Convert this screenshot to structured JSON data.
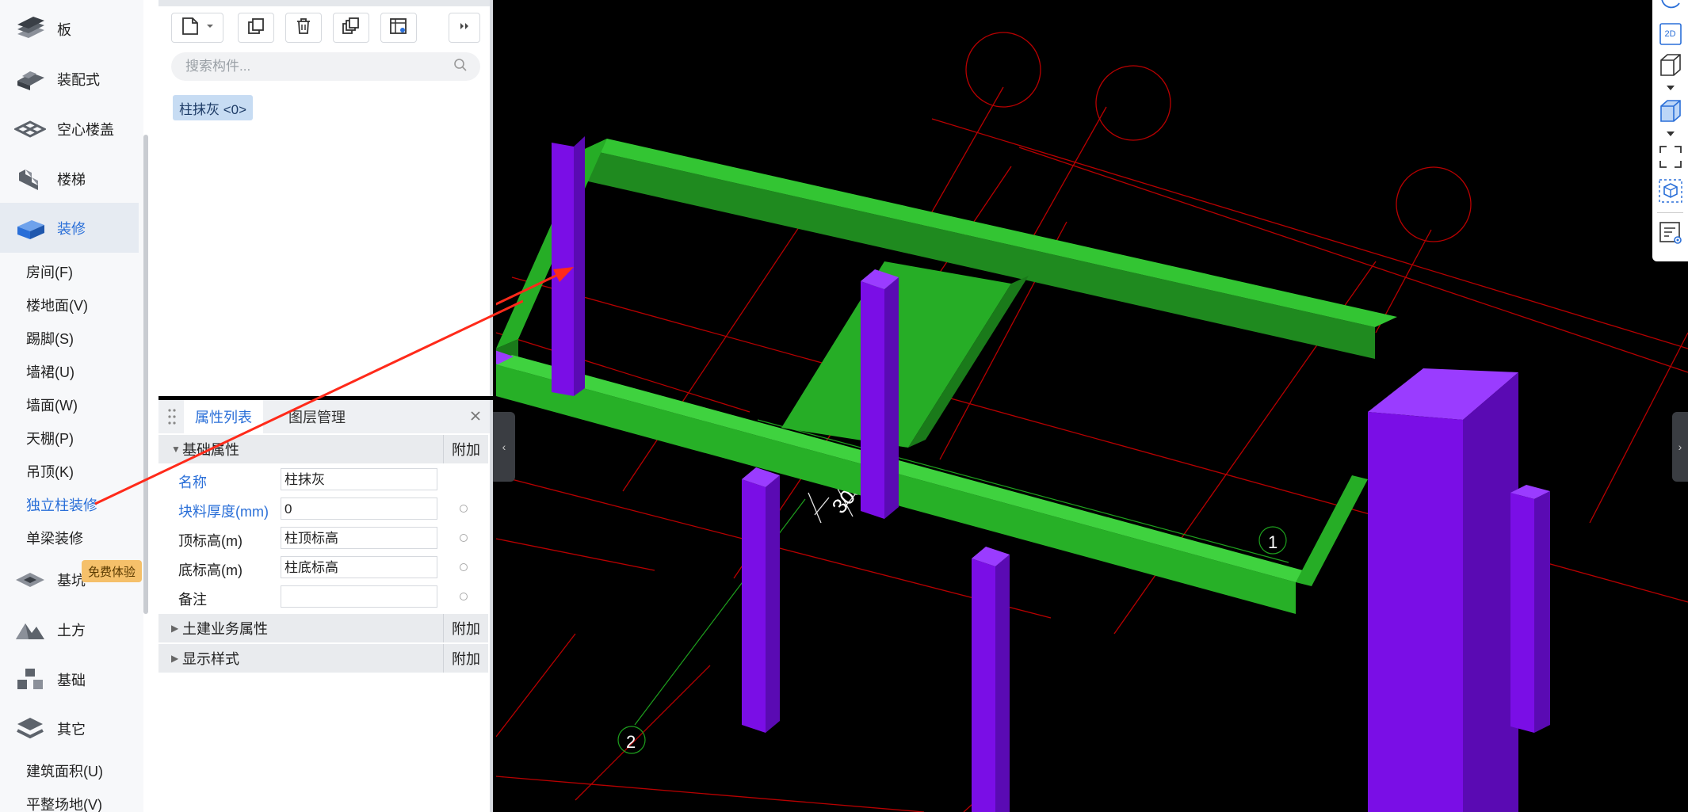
{
  "sidebar": {
    "categories": [
      {
        "label": "板",
        "icon": "slab-icon"
      },
      {
        "label": "装配式",
        "icon": "prefab-icon"
      },
      {
        "label": "空心楼盖",
        "icon": "hollow-floor-icon"
      },
      {
        "label": "楼梯",
        "icon": "stairs-icon"
      },
      {
        "label": "装修",
        "icon": "decoration-icon",
        "active": true
      }
    ],
    "decoration_items": [
      {
        "label": "房间(F)"
      },
      {
        "label": "楼地面(V)"
      },
      {
        "label": "踢脚(S)"
      },
      {
        "label": "墙裙(U)"
      },
      {
        "label": "墙面(W)"
      },
      {
        "label": "天棚(P)"
      },
      {
        "label": "吊顶(K)"
      },
      {
        "label": "独立柱装修",
        "active": true
      },
      {
        "label": "单梁装修"
      }
    ],
    "lower_categories": [
      {
        "label": "基坑",
        "icon": "foundation-pit-icon"
      },
      {
        "label": "土方",
        "icon": "earthwork-icon"
      },
      {
        "label": "基础",
        "icon": "foundation-icon"
      },
      {
        "label": "其它",
        "icon": "other-icon"
      }
    ],
    "other_items": [
      {
        "label": "建筑面积(U)"
      },
      {
        "label": "平整场地(V)"
      }
    ],
    "free_badge": "免费体验"
  },
  "component_panel": {
    "search_placeholder": "搜索构件...",
    "component_chip": "柱抹灰 <0>"
  },
  "property_panel": {
    "tabs": [
      {
        "label": "属性列表",
        "active": true
      },
      {
        "label": "图层管理"
      }
    ],
    "group_basic": "基础属性",
    "add_label": "附加",
    "rows": [
      {
        "label": "名称",
        "value": "柱抹灰"
      },
      {
        "label": "块料厚度(mm)",
        "value": "0"
      },
      {
        "label": "顶标高(m)",
        "value": "柱顶标高"
      },
      {
        "label": "底标高(m)",
        "value": "柱底标高"
      },
      {
        "label": "备注",
        "value": ""
      }
    ],
    "group_civil": "土建业务属性",
    "group_display": "显示样式"
  },
  "viewport": {
    "dimension_label": "300",
    "axis_1": "1",
    "axis_2": "2"
  },
  "right_toolbar": {
    "view_2d_label": "2D"
  },
  "colors": {
    "accent": "#2a6fd8",
    "beam_green": "#26ad26",
    "column_purple": "#7a0ee6",
    "grid_red": "#b80000",
    "annotation_red": "#ff2a1a"
  }
}
